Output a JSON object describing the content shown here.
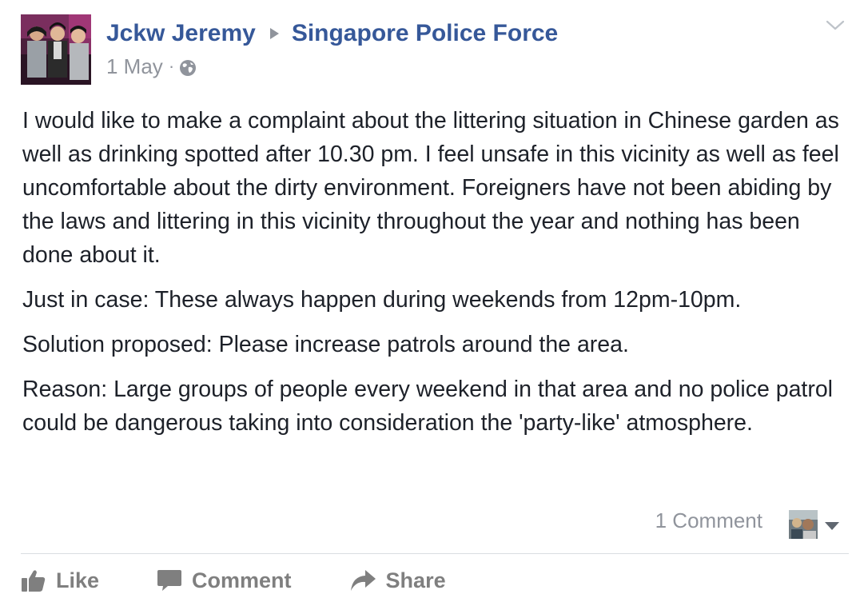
{
  "header": {
    "author": "Jckw Jeremy",
    "target_page": "Singapore Police Force",
    "date": "1 May",
    "separator": "·",
    "privacy_icon": "globe-icon",
    "menu_icon": "chevron-down-icon"
  },
  "post": {
    "paragraphs": [
      "I would like to make a complaint about the littering situation in Chinese garden as well as drinking spotted after 10.30 pm. I feel unsafe in this vicinity as well as feel uncomfortable about the dirty environment. Foreigners have not been abiding by the laws and littering in this vicinity throughout the year and nothing has been done about it.",
      "Just in case: These always happen during weekends from 12pm-10pm.",
      "Solution proposed: Please increase patrols around the area.",
      "Reason: Large groups of people every weekend in that area and no police patrol could be dangerous taking into consideration the 'party-like' atmosphere."
    ]
  },
  "footer": {
    "comment_count": "1 Comment",
    "actions": {
      "like": "Like",
      "comment": "Comment",
      "share": "Share"
    }
  },
  "colors": {
    "link": "#365899",
    "meta": "#90949c",
    "text": "#1d2129",
    "action": "#7f7f7f",
    "divider": "#dadde1"
  }
}
